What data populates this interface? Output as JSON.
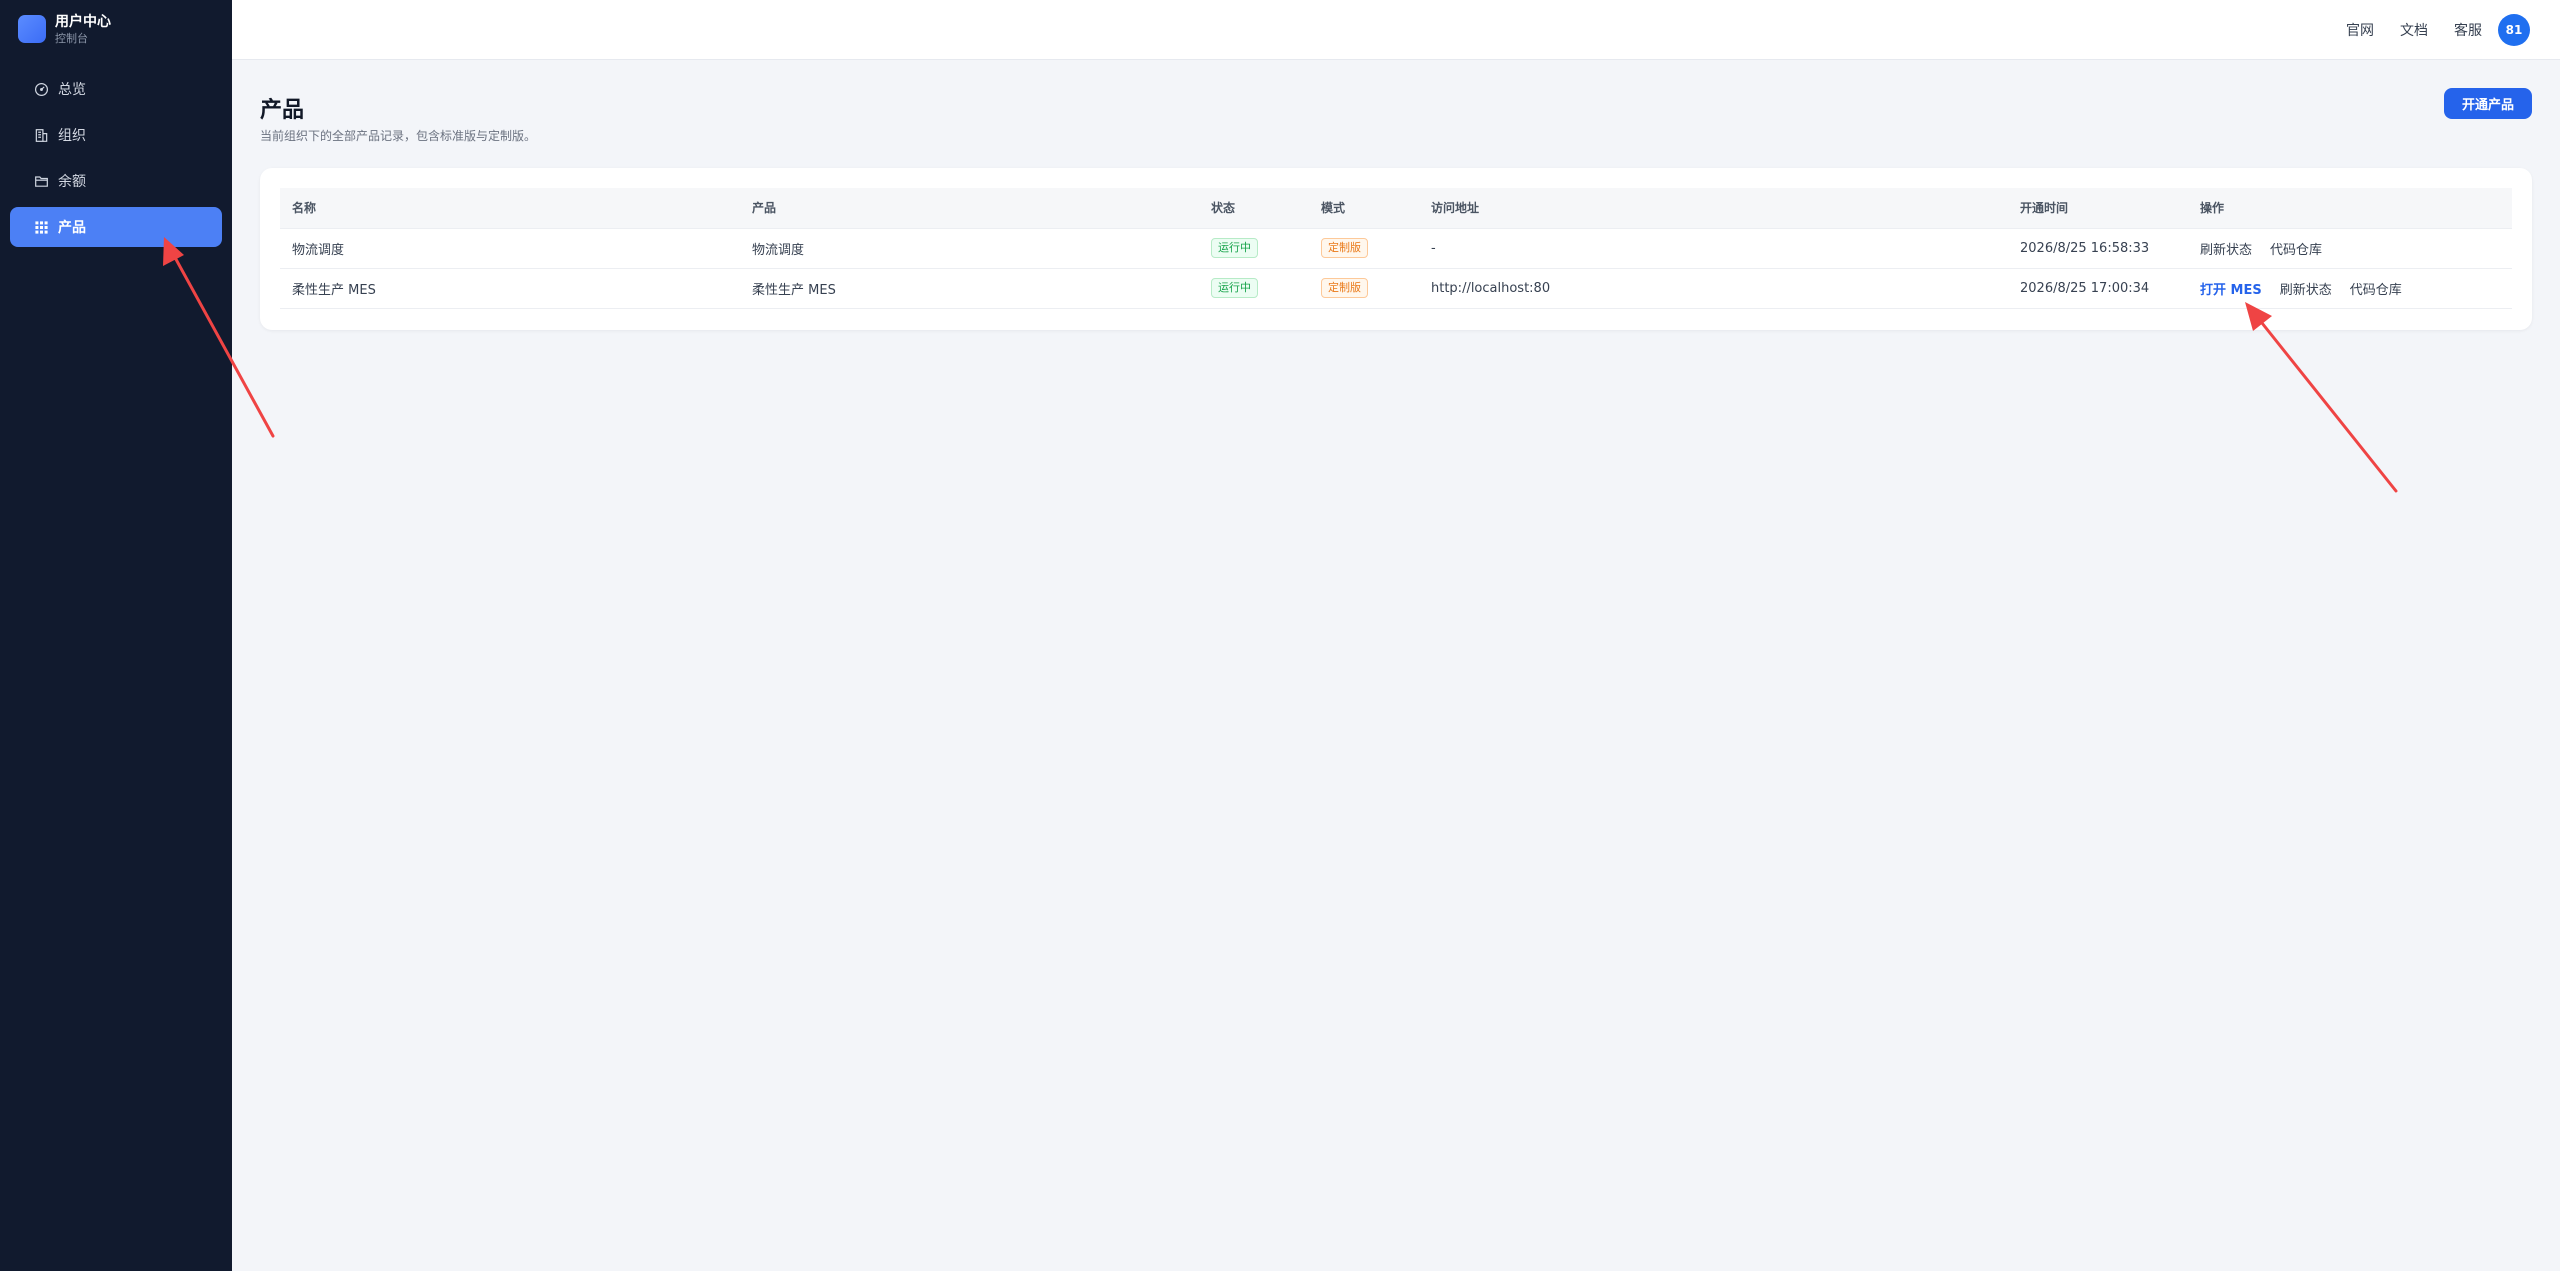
{
  "brand": {
    "title": "用户中心",
    "subtitle": "控制台"
  },
  "sidebar": {
    "items": [
      {
        "label": "总览",
        "icon": "gauge-icon"
      },
      {
        "label": "组织",
        "icon": "building-icon"
      },
      {
        "label": "余额",
        "icon": "folder-icon"
      },
      {
        "label": "产品",
        "icon": "grid-icon",
        "active": true
      }
    ]
  },
  "topbar": {
    "links": [
      "官网",
      "文档",
      "客服"
    ],
    "avatar": "81"
  },
  "page": {
    "title": "产品",
    "description": "当前组织下的全部产品记录，包含标准版与定制版。",
    "primary_button": "开通产品"
  },
  "table": {
    "headers": [
      "名称",
      "产品",
      "状态",
      "模式",
      "访问地址",
      "开通时间",
      "操作"
    ],
    "rows": [
      {
        "name": "物流调度",
        "product": "物流调度",
        "status": "运行中",
        "mode": "定制版",
        "url": "-",
        "opened_at": "2026/8/25 16:58:33",
        "actions": [
          "刷新状态",
          "代码仓库"
        ]
      },
      {
        "name": "柔性生产 MES",
        "product": "柔性生产 MES",
        "status": "运行中",
        "mode": "定制版",
        "url": "http://localhost:80",
        "opened_at": "2026/8/25 17:00:34",
        "primary_action": "打开 MES",
        "actions": [
          "刷新状态",
          "代码仓库"
        ]
      }
    ]
  },
  "colors": {
    "sidebar_bg": "#111a2e",
    "accent": "#2563eb",
    "active_nav": "#4c80f5",
    "status_green": "#16a34a",
    "mode_orange": "#ea7a1a",
    "annotation_red": "#ef4444"
  }
}
